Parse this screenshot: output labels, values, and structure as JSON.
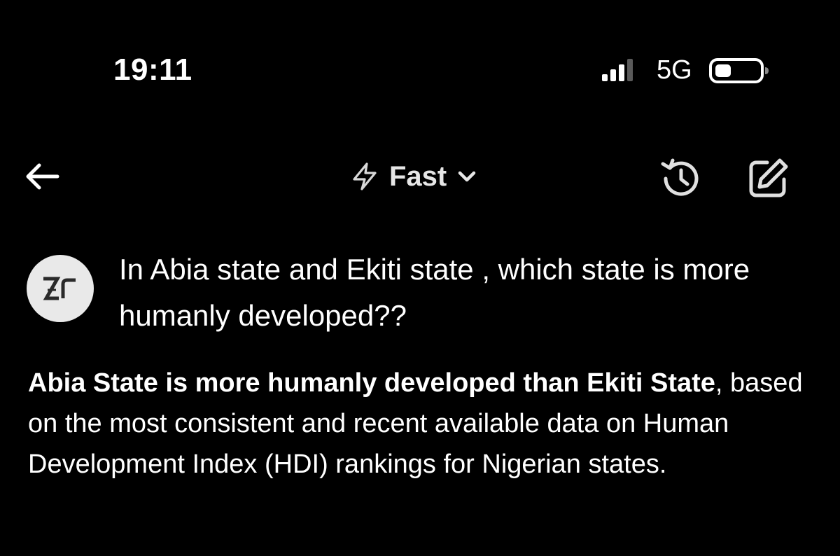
{
  "status_bar": {
    "time": "19:11",
    "network": "5G",
    "signal_icon": "cellular-signal-icon",
    "battery_icon": "battery-icon"
  },
  "nav": {
    "back_icon": "arrow-left-icon",
    "mode_icon": "lightning-bolt-icon",
    "mode_label": "Fast",
    "mode_chevron_icon": "chevron-down-icon",
    "history_icon": "history-icon",
    "compose_icon": "edit-icon"
  },
  "conversation": {
    "avatar_text": "Zr",
    "question": "In Abia state and  Ekiti state , which state is more humanly developed??",
    "answer_bold": "Abia State is more humanly developed than Ekiti State",
    "answer_rest": ", based on the most consistent and recent available data on Human Development Index (HDI) rankings for Nigerian states."
  },
  "colors": {
    "background": "#000000",
    "text": "#ffffff",
    "avatar_bg": "#e9e9e9",
    "avatar_fg": "#2a2a2a"
  }
}
